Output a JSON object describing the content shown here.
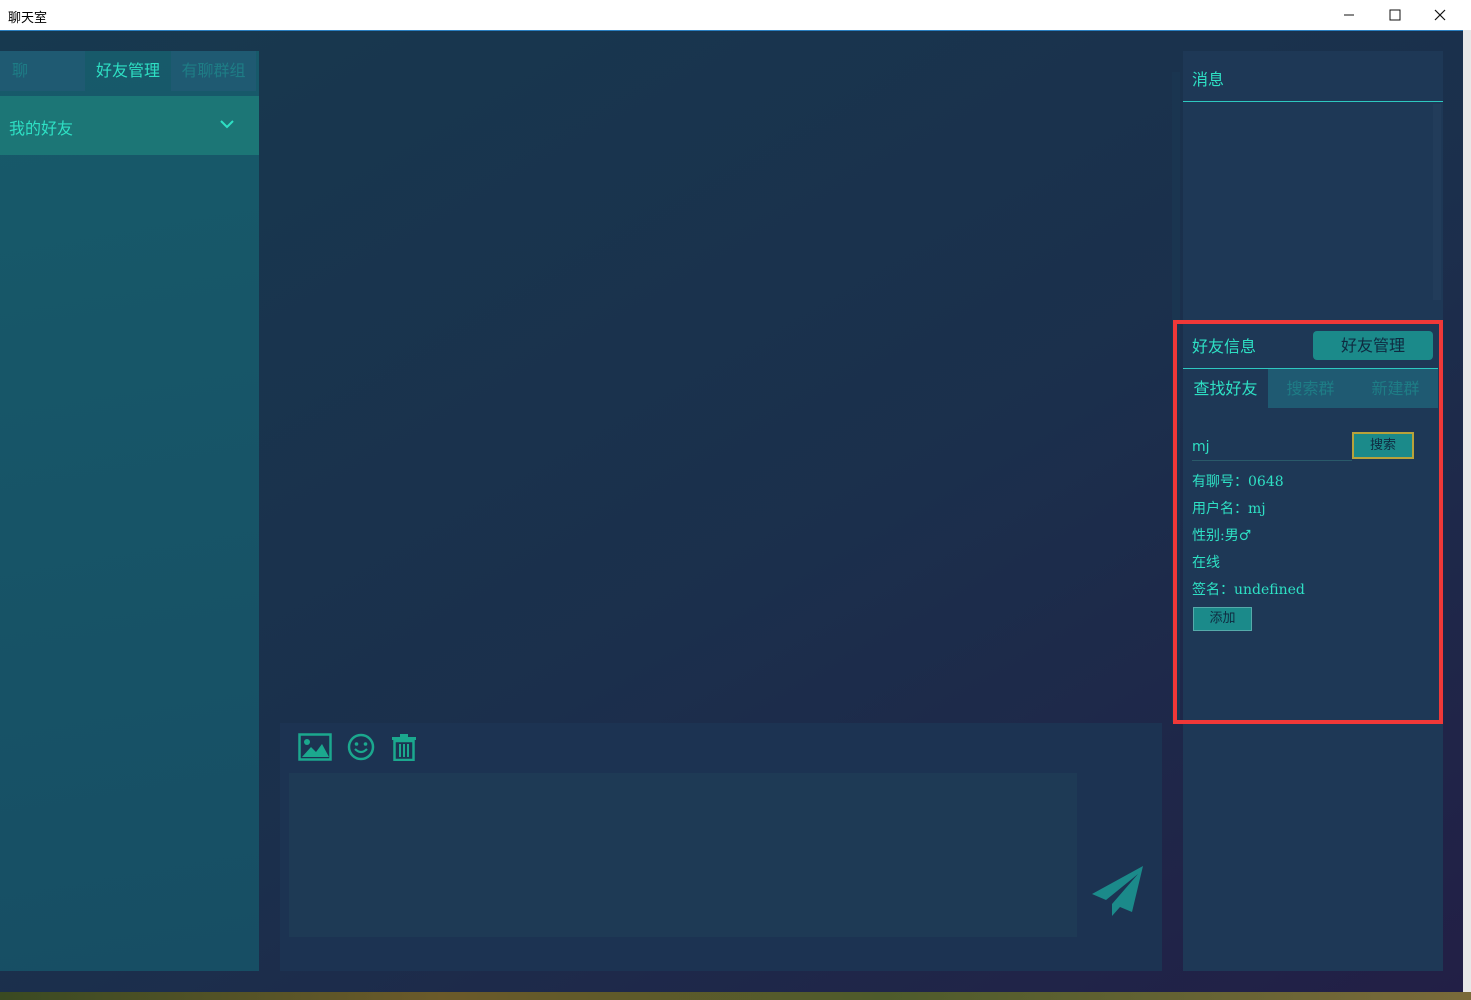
{
  "window": {
    "title": "聊天室"
  },
  "left": {
    "tabs": [
      "聊 天",
      "好友管理",
      "有聊群组"
    ],
    "active_tab": "好友管理",
    "group_label": "我的好友"
  },
  "toolbar": {
    "icons": [
      "image-icon",
      "emoji-icon",
      "trash-icon",
      "send-icon"
    ]
  },
  "message_box": {
    "value": ""
  },
  "right": {
    "messages_title": "消息",
    "friend_info_title": "好友信息",
    "friend_manage_button": "好友管理",
    "tabs": [
      "查找好友",
      "搜索群",
      "新建群"
    ],
    "active_tab": "查找好友",
    "search_value": "mj",
    "search_button": "搜索",
    "result": {
      "id_line": "有聊号：0648",
      "username_line": "用户名：mj",
      "gender_line": "性别:男♂",
      "status_line": "在线",
      "signature_line": "签名：undefined"
    },
    "add_button": "添加"
  },
  "colors": {
    "accent": "#2ee0c4",
    "highlight_box": "#f03838",
    "button_teal": "#1b8a8a"
  }
}
